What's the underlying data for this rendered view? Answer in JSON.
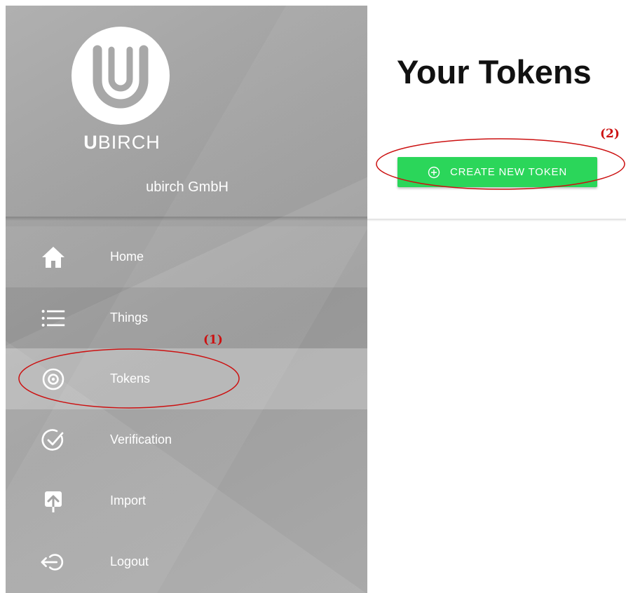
{
  "sidebar": {
    "brand_bold": "U",
    "brand_rest": "BIRCH",
    "organization": "ubirch GmbH",
    "items": [
      {
        "label": "Home",
        "icon": "home-icon"
      },
      {
        "label": "Things",
        "icon": "list-icon"
      },
      {
        "label": "Tokens",
        "icon": "target-icon",
        "active": true
      },
      {
        "label": "Verification",
        "icon": "check-circle-icon"
      },
      {
        "label": "Import",
        "icon": "upload-icon"
      },
      {
        "label": "Logout",
        "icon": "logout-icon"
      }
    ]
  },
  "main": {
    "title": "Your Tokens",
    "create_button_label": "CREATE NEW TOKEN"
  },
  "annotations": {
    "marker_1": "(1)",
    "marker_2": "(2)"
  },
  "colors": {
    "create_button": "#2bd65a",
    "annotation": "#cc1111",
    "sidebar_gray": "#a8a8a8"
  }
}
